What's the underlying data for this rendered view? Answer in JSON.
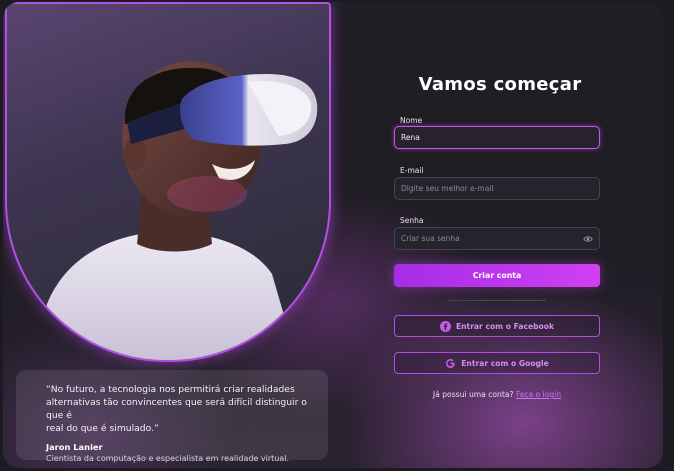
{
  "quote": {
    "lines": [
      "“No futuro, a tecnologia nos permitirá criar realidades",
      "alternativas tão convincentes que será difícil distinguir o que é",
      "real do que é simulado.”"
    ],
    "author": "Jaron Lanier",
    "role": "Cientista da computação e especialista em realidade virtual."
  },
  "form": {
    "title": "Vamos começar",
    "name_label": "Nome",
    "name_value": "Rena",
    "email_label": "E-mail",
    "email_placeholder": "Digite seu melhor e-mail",
    "password_label": "Senha",
    "password_placeholder": "Criar sua senha",
    "submit_label": "Criar conta",
    "facebook_label": "Entrar com o Facebook",
    "google_label": "Entrar com o Google",
    "signin_prompt": "Já possui uma conta?",
    "signin_link": "Faça o login"
  },
  "colors": {
    "accent": "#c457f0",
    "button_gradient_start": "#a52de6",
    "button_gradient_end": "#d040f2",
    "background": "#1f1d24"
  },
  "icons": {
    "password_toggle": "eye-icon",
    "facebook": "facebook-icon",
    "google": "google-icon"
  }
}
